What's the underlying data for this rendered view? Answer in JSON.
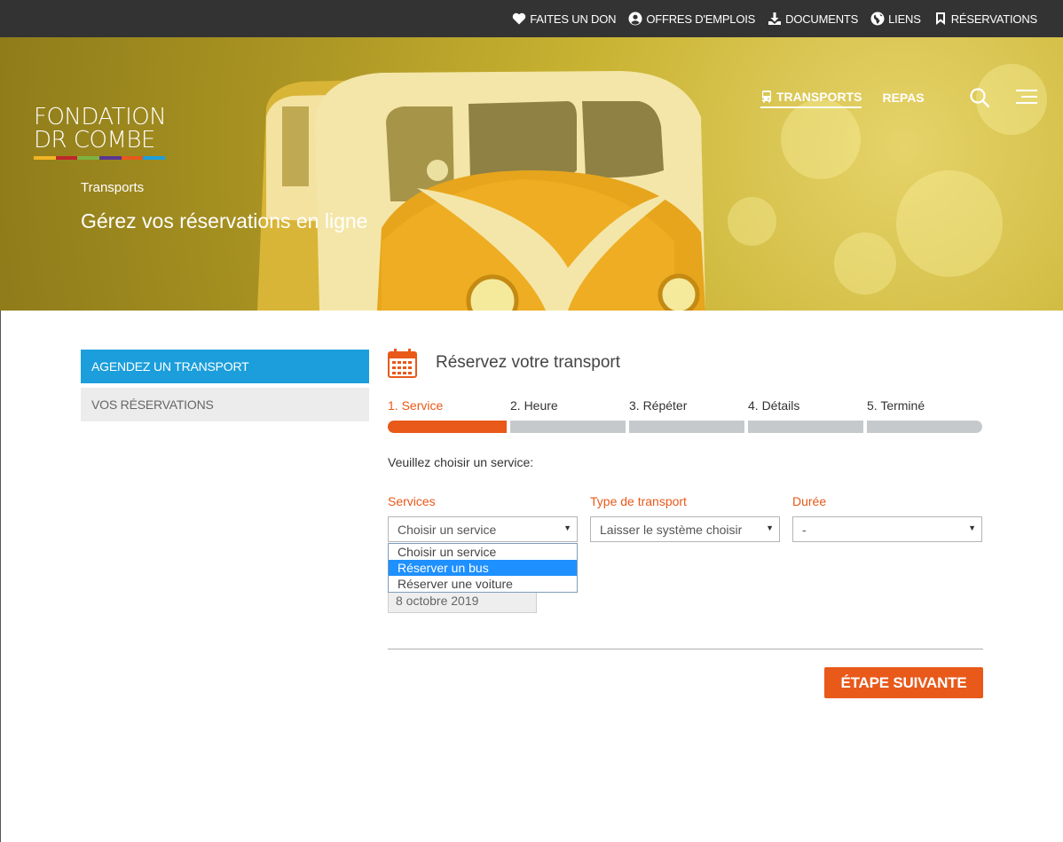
{
  "colors": {
    "accent_orange": "#e8591a",
    "accent_blue": "#1b9edb",
    "topbar_bg": "#333333",
    "logo_bar": [
      "#f2b624",
      "#c0252b",
      "#7cb341",
      "#5a3592",
      "#e8591a",
      "#1b9edb"
    ]
  },
  "topbar": {
    "items": [
      {
        "icon": "heart-icon",
        "label": "FAITES UN DON"
      },
      {
        "icon": "user-circle-icon",
        "label": "OFFRES D'EMPLOIS"
      },
      {
        "icon": "download-icon",
        "label": "DOCUMENTS"
      },
      {
        "icon": "globe-icon",
        "label": "LIENS"
      },
      {
        "icon": "bookmark-icon",
        "label": "RÉSERVATIONS"
      }
    ]
  },
  "logo": {
    "line1": "FONDATION",
    "line2": "DR COMBE"
  },
  "nav": {
    "items": [
      {
        "icon": "bus-icon",
        "label": "TRANSPORTS",
        "active": true
      },
      {
        "label": "REPAS",
        "active": false
      }
    ],
    "search_icon": "search-icon",
    "menu_icon": "hamburger-menu-icon"
  },
  "hero": {
    "breadcrumb": "Transports",
    "title": "Gérez vos réservations en ligne"
  },
  "sidebar": {
    "items": [
      {
        "label": "AGENDEZ UN TRANSPORT",
        "active": true
      },
      {
        "label": "VOS RÉSERVATIONS",
        "active": false
      }
    ]
  },
  "panel": {
    "icon": "calendar-icon",
    "title": "Réservez votre transport",
    "steps": [
      {
        "label": "1. Service",
        "current": true
      },
      {
        "label": "2. Heure",
        "current": false
      },
      {
        "label": "3. Répéter",
        "current": false
      },
      {
        "label": "4. Détails",
        "current": false
      },
      {
        "label": "5. Terminé",
        "current": false
      }
    ],
    "instruction": "Veuillez choisir un service:",
    "fields": {
      "services": {
        "label": "Services",
        "value": "Choisir un service"
      },
      "transport_type": {
        "label": "Type de transport",
        "value": "Laisser le système choisir"
      },
      "duration": {
        "label": "Durée",
        "value": "-"
      }
    },
    "services_options": [
      {
        "label": "Choisir un service",
        "highlighted": false
      },
      {
        "label": "Réserver un bus",
        "highlighted": true
      },
      {
        "label": "Réserver une voiture",
        "highlighted": false
      }
    ],
    "date": "8 octobre 2019",
    "next_button": "ÉTAPE SUIVANTE"
  }
}
